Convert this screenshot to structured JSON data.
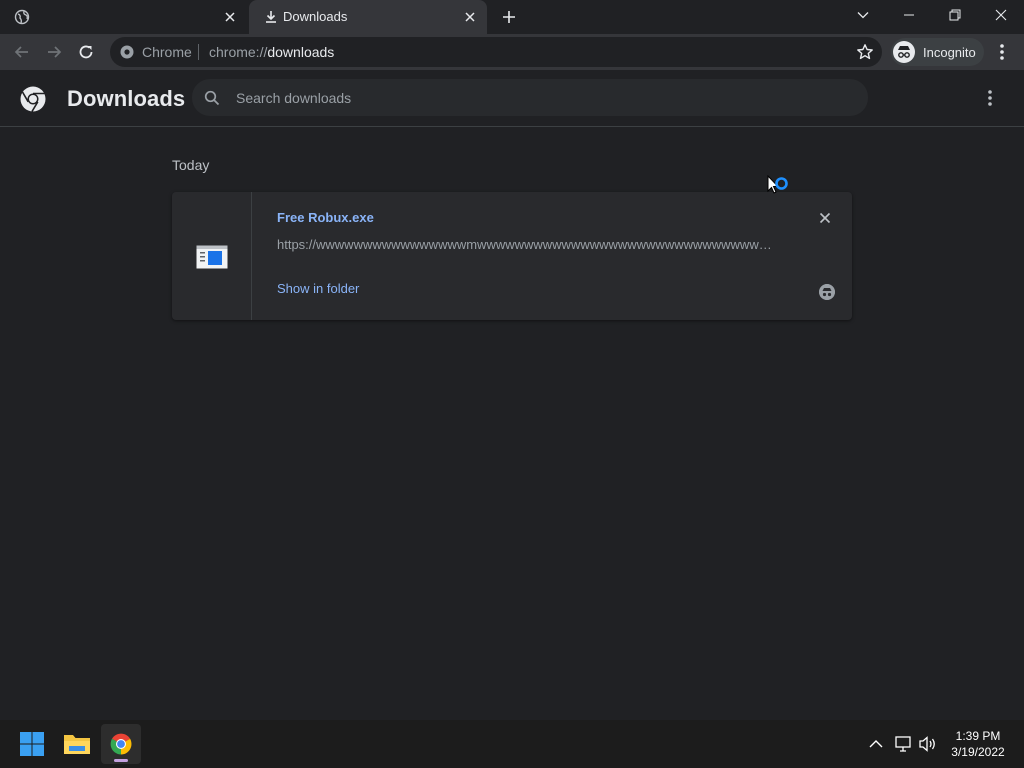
{
  "tabs": [
    {
      "title": "",
      "icon": "globe-icon"
    },
    {
      "title": "Downloads",
      "icon": "download-icon"
    }
  ],
  "omnibox": {
    "chip": "Chrome",
    "url_scheme": "chrome://",
    "url_path": "downloads"
  },
  "profile": {
    "label": "Incognito"
  },
  "downloads_page": {
    "title": "Downloads",
    "search_placeholder": "Search downloads"
  },
  "date_header": "Today",
  "items": [
    {
      "file_name": "Free Robux.exe",
      "url": "https://wwwwwwwwwwwwwwwwmwwwwwwwwwwwwwwwwwwwwwwwwwwwwwwwwwwwwwww....",
      "action_label": "Show in folder"
    }
  ],
  "taskbar": {
    "apps": [
      "windows-start",
      "file-explorer",
      "chrome"
    ],
    "time": "1:39 PM",
    "date": "3/19/2022"
  },
  "colors": {
    "background": "#202124",
    "toolbar": "#35363a",
    "link": "#8ab4f8",
    "text": "#e8eaed",
    "muted": "#9aa0a6"
  }
}
